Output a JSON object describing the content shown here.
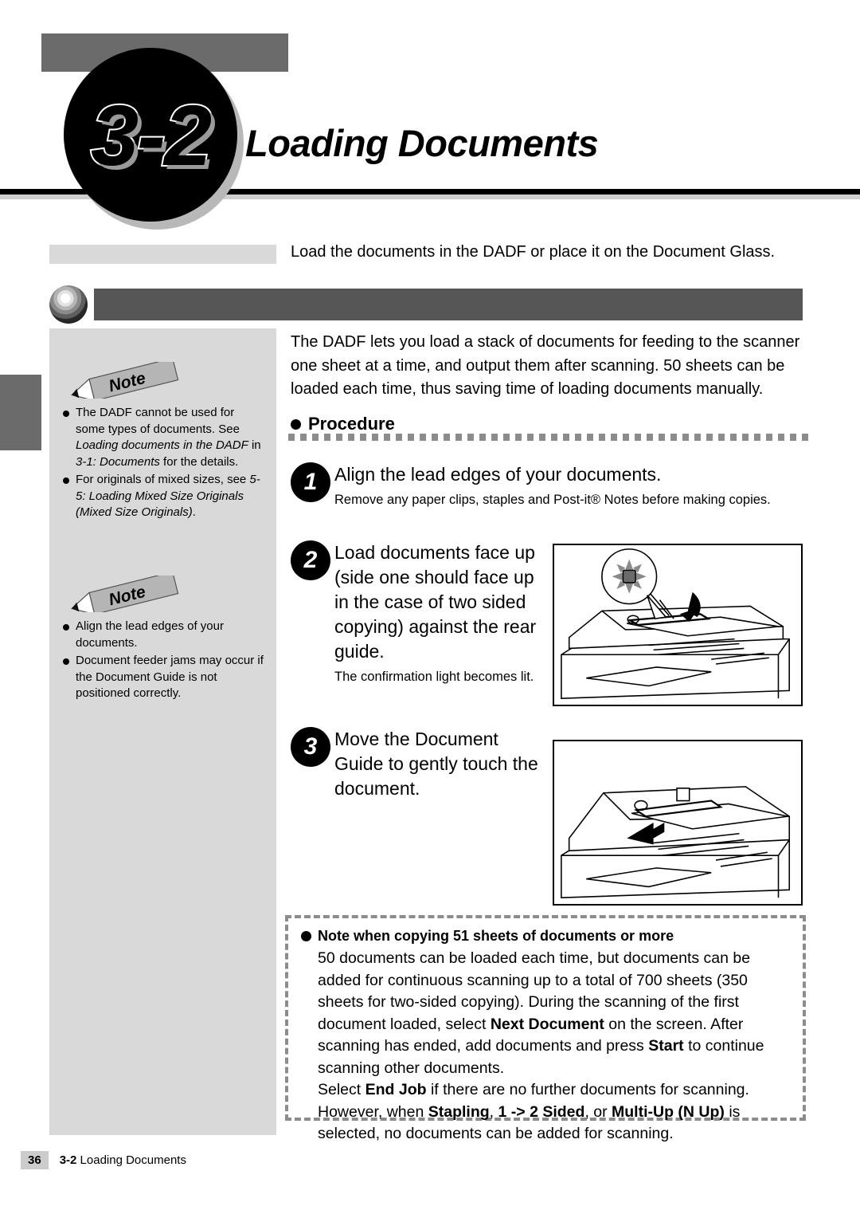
{
  "header": {
    "section_number": "3-2",
    "title": "Loading Documents"
  },
  "intro": {
    "text": "Load the documents in the DADF or place it on the Document Glass."
  },
  "body": {
    "paragraph": "The DADF lets you load a stack of documents for feeding to the scanner one sheet at a time, and output them after scanning. 50 sheets can be loaded each time, thus saving time of loading documents manually."
  },
  "procedure": {
    "heading": "Procedure"
  },
  "steps": [
    {
      "number": "1",
      "title": "Align the lead edges of your documents.",
      "subtext": "Remove any paper clips, staples and Post-it® Notes before making copies."
    },
    {
      "number": "2",
      "title": "Load documents face up (side one should face up in the case of two sided copying) against the rear guide.",
      "subtext": "The confirmation light becomes lit."
    },
    {
      "number": "3",
      "title": "Move the Document Guide to gently touch the document.",
      "subtext": ""
    }
  ],
  "notes": [
    {
      "label": "Note",
      "items": [
        {
          "parts": [
            {
              "t": "The DADF cannot be used for some types of documents. See ",
              "i": false
            },
            {
              "t": "Loading documents in the DADF",
              "i": true
            },
            {
              "t": " in ",
              "i": false
            },
            {
              "t": "3-1: Documents",
              "i": true
            },
            {
              "t": " for the details.",
              "i": false
            }
          ]
        },
        {
          "parts": [
            {
              "t": "For originals of mixed sizes, see ",
              "i": false
            },
            {
              "t": "5-5: Loading Mixed Size Originals (Mixed Size Originals)",
              "i": true
            },
            {
              "t": ".",
              "i": false
            }
          ]
        }
      ]
    },
    {
      "label": "Note",
      "items": [
        {
          "parts": [
            {
              "t": "Align the lead edges of your documents.",
              "i": false
            }
          ]
        },
        {
          "parts": [
            {
              "t": "Document feeder jams may occur if the Document Guide is not positioned correctly.",
              "i": false
            }
          ]
        }
      ]
    }
  ],
  "callout": {
    "heading": "Note when copying 51 sheets of documents or more",
    "paragraphs": [
      [
        {
          "t": "50 documents can be loaded each time, but documents can be added for continuous scanning up to a total of 700 sheets (350 sheets for two-sided copying). During the scanning of the first document loaded, select ",
          "b": false
        },
        {
          "t": "Next Document",
          "b": true
        },
        {
          "t": " on the screen. After scanning has ended, add documents and press ",
          "b": false
        },
        {
          "t": "Start",
          "b": true
        },
        {
          "t": " to continue scanning other documents.",
          "b": false
        }
      ],
      [
        {
          "t": "Select ",
          "b": false
        },
        {
          "t": "End Job",
          "b": true
        },
        {
          "t": " if there are no further documents for scanning.",
          "b": false
        }
      ],
      [
        {
          "t": "However, when ",
          "b": false
        },
        {
          "t": "Stapling",
          "b": true
        },
        {
          "t": ", ",
          "b": false
        },
        {
          "t": "1 -> 2 Sided",
          "b": true
        },
        {
          "t": ", or ",
          "b": false
        },
        {
          "t": "Multi-Up (N Up)",
          "b": true
        },
        {
          "t": " is selected, no documents can be added for scanning.",
          "b": false
        }
      ]
    ]
  },
  "footer": {
    "page_number": "36",
    "section": "3-2",
    "title": "Loading Documents"
  },
  "colors": {
    "band_dark": "#565656",
    "sidebar_gray": "#d9d9d9",
    "header_block_gray": "#6b6b6b",
    "dash_gray": "#8c8c8c"
  }
}
